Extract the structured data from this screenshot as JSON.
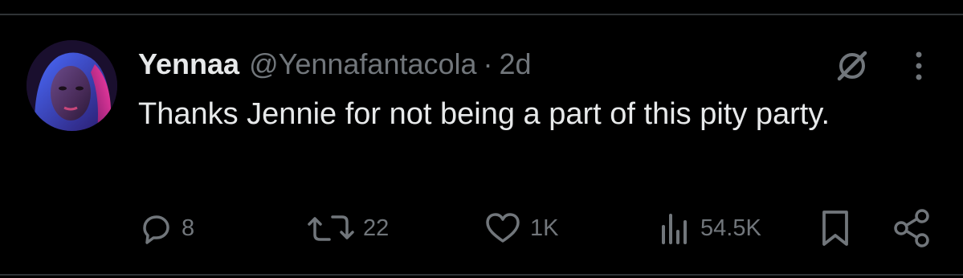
{
  "tweet": {
    "display_name": "Yennaa",
    "handle": "@Yennafantacola",
    "separator": "·",
    "time": "2d",
    "text": "Thanks Jennie for not being a part of this pity party."
  },
  "actions": {
    "replies": "8",
    "retweets": "22",
    "likes": "1K",
    "views": "54.5K"
  },
  "icons": [
    "grok-icon",
    "more-icon",
    "reply-icon",
    "retweet-icon",
    "like-icon",
    "views-icon",
    "bookmark-icon",
    "share-icon"
  ],
  "colors": {
    "background": "#000000",
    "primary_text": "#e7e9ea",
    "secondary_text": "#71767b",
    "divider": "#2f3336"
  }
}
